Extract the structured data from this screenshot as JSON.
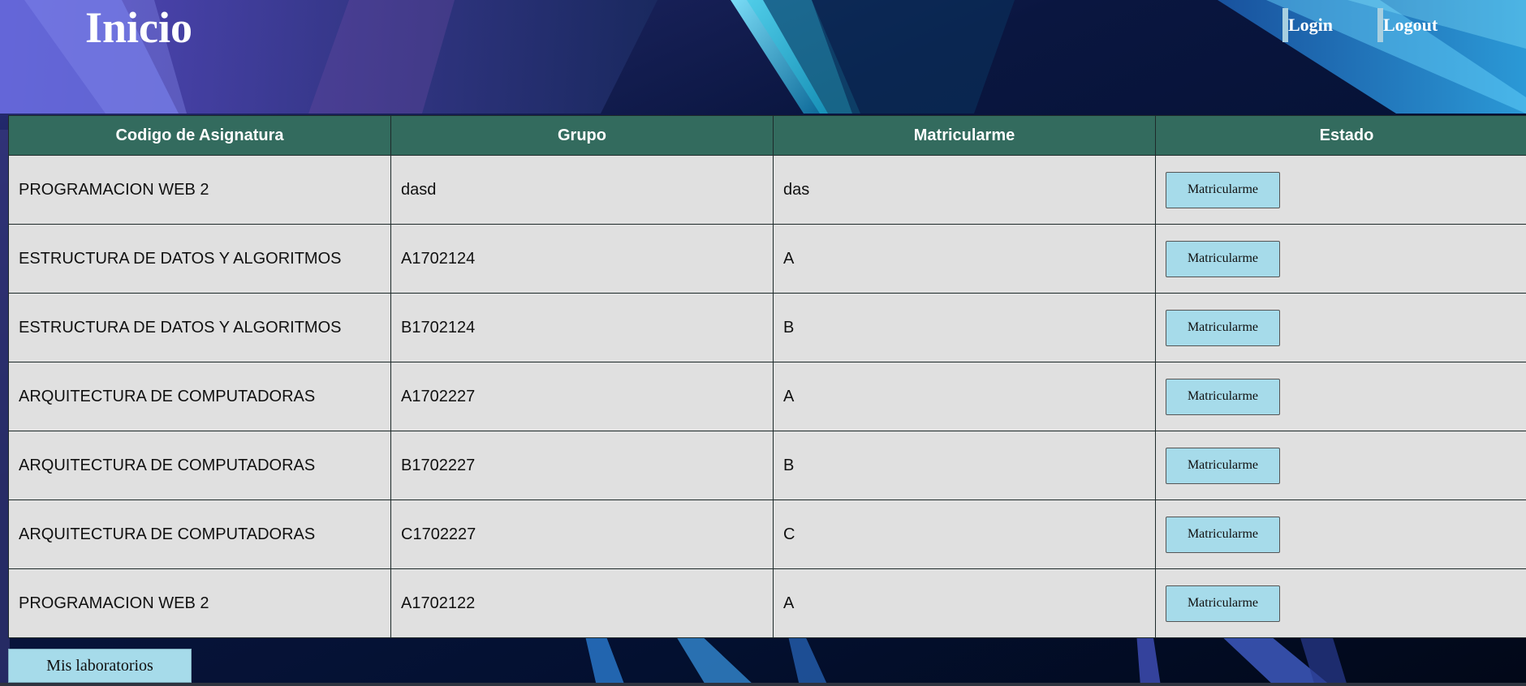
{
  "header": {
    "title": "Inicio",
    "nav": {
      "login": "Login",
      "logout": "Logout"
    }
  },
  "table": {
    "columns": [
      "Codigo de Asignatura",
      "Grupo",
      "Matricularme",
      "Estado"
    ],
    "rows": [
      {
        "asignatura": "PROGRAMACION WEB 2",
        "grupo": "dasd",
        "matricularme": "das",
        "action": "Matricularme"
      },
      {
        "asignatura": "ESTRUCTURA DE DATOS Y ALGORITMOS",
        "grupo": "A1702124",
        "matricularme": "A",
        "action": "Matricularme"
      },
      {
        "asignatura": "ESTRUCTURA DE DATOS Y ALGORITMOS",
        "grupo": "B1702124",
        "matricularme": "B",
        "action": "Matricularme"
      },
      {
        "asignatura": "ARQUITECTURA DE COMPUTADORAS",
        "grupo": "A1702227",
        "matricularme": "A",
        "action": "Matricularme"
      },
      {
        "asignatura": "ARQUITECTURA DE COMPUTADORAS",
        "grupo": "B1702227",
        "matricularme": "B",
        "action": "Matricularme"
      },
      {
        "asignatura": "ARQUITECTURA DE COMPUTADORAS",
        "grupo": "C1702227",
        "matricularme": "C",
        "action": "Matricularme"
      },
      {
        "asignatura": "PROGRAMACION WEB 2",
        "grupo": "A1702122",
        "matricularme": "A",
        "action": "Matricularme"
      }
    ]
  },
  "footer": {
    "labs_button": "Mis laboratorios"
  },
  "colors": {
    "header_row": "#336b5e",
    "cell_bg": "#e0e0e0",
    "button_bg": "#a6dbea",
    "page_bg": "#04102a"
  }
}
